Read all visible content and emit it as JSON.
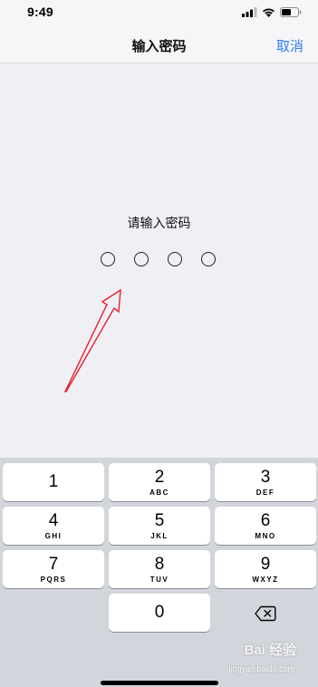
{
  "status_bar": {
    "time": "9:49",
    "icons": [
      "signal-icon",
      "wifi-icon",
      "battery-icon"
    ]
  },
  "nav": {
    "title": "输入密码",
    "cancel_label": "取消"
  },
  "passcode": {
    "prompt": "请输入密码",
    "digits_entered": 0,
    "length": 4
  },
  "keypad": {
    "keys": [
      {
        "digit": "1",
        "letters": ""
      },
      {
        "digit": "2",
        "letters": "ABC"
      },
      {
        "digit": "3",
        "letters": "DEF"
      },
      {
        "digit": "4",
        "letters": "GHI"
      },
      {
        "digit": "5",
        "letters": "JKL"
      },
      {
        "digit": "6",
        "letters": "MNO"
      },
      {
        "digit": "7",
        "letters": "PQRS"
      },
      {
        "digit": "8",
        "letters": "TUV"
      },
      {
        "digit": "9",
        "letters": "WXYZ"
      },
      {
        "digit": "0",
        "letters": ""
      }
    ],
    "delete_icon": "delete-backspace-icon"
  },
  "watermark": {
    "text": "Bai 经验",
    "url": "jingyan.baidu.com"
  },
  "colors": {
    "accent": "#2f7ff6",
    "annotation_arrow": "#e8202a",
    "keypad_bg": "#d2d5db",
    "page_bg": "#efeff4"
  }
}
